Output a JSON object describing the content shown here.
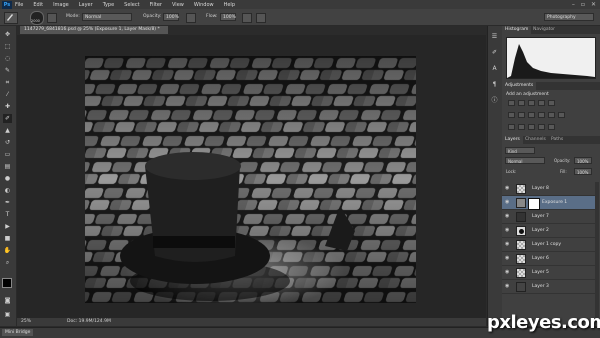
{
  "menubar": {
    "logo": "Ps",
    "items": [
      "File",
      "Edit",
      "Image",
      "Layer",
      "Type",
      "Select",
      "Filter",
      "View",
      "Window",
      "Help"
    ]
  },
  "options": {
    "brush_size": "2000",
    "mode_label": "Mode:",
    "mode_value": "Normal",
    "opacity_label": "Opacity:",
    "opacity_value": "100%",
    "flow_label": "Flow:",
    "flow_value": "100%",
    "workspace": "Photography"
  },
  "document": {
    "tab_title": "1147279_6841816.psd @ 25% (Exposure 1, Layer Mask/8) *",
    "zoom": "25%",
    "doc_info": "Doc: 19.9M/124.9M"
  },
  "minibridge": {
    "label": "Mini Bridge"
  },
  "panels": {
    "histogram_tab": "Histogram",
    "navigator_tab": "Navigator",
    "adjustments_tab": "Adjustments",
    "adjustments_hint": "Add an adjustment",
    "layers_tab": "Layers",
    "channels_tab": "Channels",
    "paths_tab": "Paths",
    "kind_label": "Kind",
    "blend_mode": "Normal",
    "opacity_label": "Opacity:",
    "opacity_value": "100%",
    "lock_label": "Lock:",
    "fill_label": "Fill:",
    "fill_value": "100%"
  },
  "layers": [
    {
      "name": "Layer 8",
      "selected": false,
      "thumb": "checker"
    },
    {
      "name": "Exposure 1",
      "selected": true,
      "thumb": "adjust"
    },
    {
      "name": "Layer 7",
      "selected": false,
      "thumb": "dark"
    },
    {
      "name": "Layer 2",
      "selected": false,
      "thumb": "hat"
    },
    {
      "name": "Layer 1 copy",
      "selected": false,
      "thumb": "checker"
    },
    {
      "name": "Layer 6",
      "selected": false,
      "thumb": "checker"
    },
    {
      "name": "Layer 5",
      "selected": false,
      "thumb": "checker"
    },
    {
      "name": "Layer 3",
      "selected": false,
      "thumb": "dark"
    }
  ],
  "watermark": "pxleyes.com",
  "colors": {
    "menubar_bg": "#3a3a3a",
    "panel_bg": "#404040",
    "selected_layer": "#5a6e87",
    "ps_logo": "#36a3f7"
  }
}
